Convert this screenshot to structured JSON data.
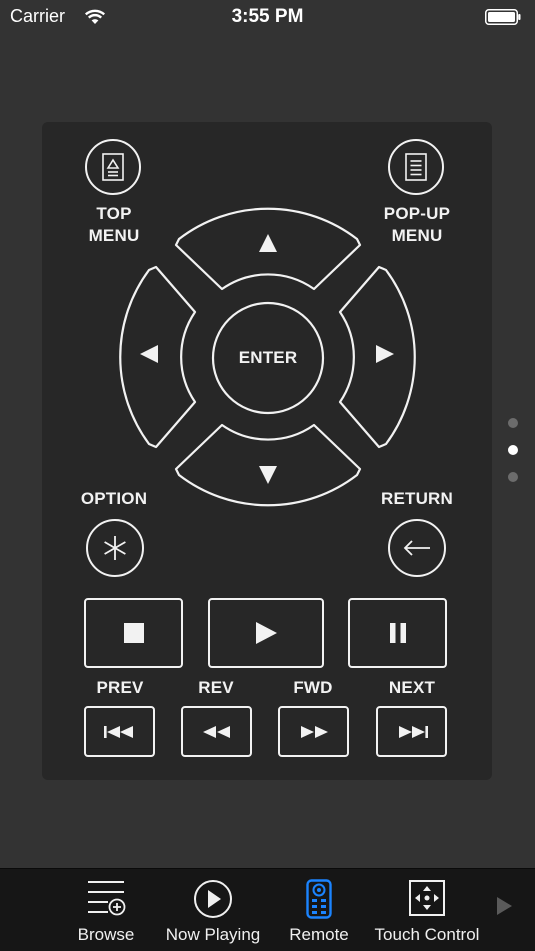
{
  "status": {
    "carrier": "Carrier",
    "time": "3:55 PM"
  },
  "remote": {
    "top_menu_line1": "TOP",
    "top_menu_line2": "MENU",
    "popup_menu_line1": "POP-UP",
    "popup_menu_line2": "MENU",
    "enter": "ENTER",
    "option": "OPTION",
    "return": "RETURN",
    "prev": "PREV",
    "rev": "REV",
    "fwd": "FWD",
    "next": "NEXT"
  },
  "pager": {
    "count": 3,
    "active_index": 1
  },
  "tabs": [
    {
      "label": "Browse",
      "icon": "browse-icon"
    },
    {
      "label": "Now Playing",
      "icon": "play-circle-icon"
    },
    {
      "label": "Remote",
      "icon": "remote-icon",
      "active": true
    },
    {
      "label": "Touch Control",
      "icon": "touch-control-icon"
    }
  ],
  "colors": {
    "accent": "#1b84ff",
    "background": "#333333",
    "panel": "#272727",
    "tabbar": "#161616"
  }
}
